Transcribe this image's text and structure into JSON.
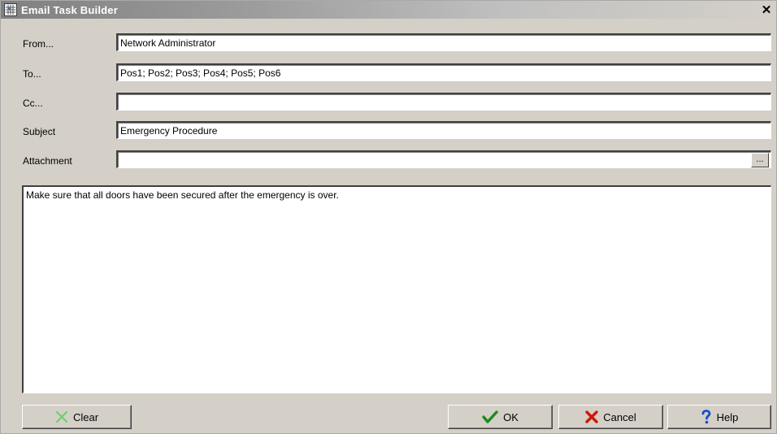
{
  "window": {
    "title": "Email Task Builder",
    "close_glyph": "✕"
  },
  "icons": {
    "app": "app-grid-icon",
    "clear": "x-clear-icon",
    "ok": "checkmark-icon",
    "cancel": "red-x-icon",
    "help": "question-icon"
  },
  "colors": {
    "ok_green": "#1e8a1e",
    "cancel_red": "#cc1a00",
    "help_blue": "#1050d0",
    "clear_green": "#6fcf6f"
  },
  "fields": {
    "from": {
      "label": "From...",
      "value": "Network Administrator"
    },
    "to": {
      "label": "To...",
      "value": "Pos1; Pos2; Pos3; Pos4; Pos5; Pos6"
    },
    "cc": {
      "label": "Cc...",
      "value": ""
    },
    "subject": {
      "label": "Subject",
      "value": "Emergency Procedure"
    },
    "attachment": {
      "label": "Attachment",
      "value": "",
      "browse_label": "..."
    }
  },
  "message": {
    "body": "Make sure that all doors have been secured after the emergency is over."
  },
  "buttons": {
    "clear": "Clear",
    "ok": "OK",
    "cancel": "Cancel",
    "help": "Help"
  }
}
